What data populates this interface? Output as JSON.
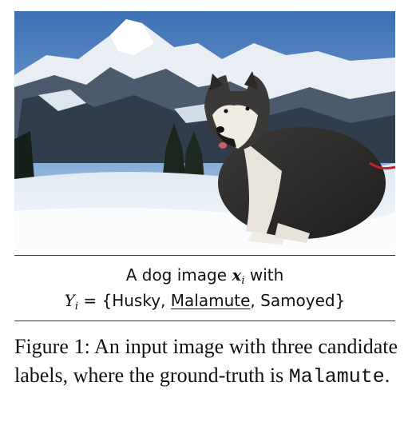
{
  "illustration": {
    "line1_prefix": "A dog image ",
    "line1_var": "x",
    "line1_sub": "i",
    "line1_suffix": " with",
    "line2_var": "Y",
    "line2_sub": "i",
    "line2_eq": " = {",
    "label_1": "Husky",
    "sep_1": ", ",
    "label_2": "Malamute",
    "sep_2": ", ",
    "label_3": "Samoyed",
    "close": "}"
  },
  "caption": {
    "figure_label": "Figure 1:",
    "text": " An input image with three candidate labels, where the ground-truth is ",
    "ground_truth": "Malamute",
    "end": "."
  }
}
